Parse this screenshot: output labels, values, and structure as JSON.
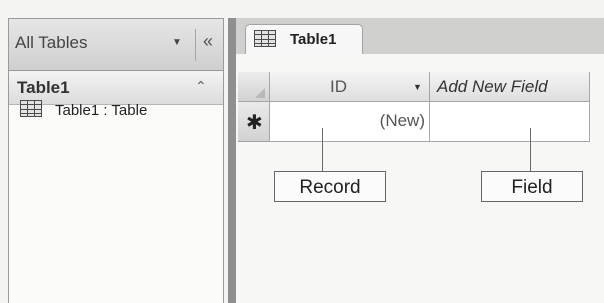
{
  "nav_pane": {
    "title": "All Tables",
    "dropdown_glyph": "▼",
    "shutter_glyph": "«",
    "group": {
      "title": "Table1",
      "collapse_glyph": "⌃"
    },
    "items": [
      {
        "label": "Table1 : Table",
        "icon": "table-icon"
      }
    ]
  },
  "document_tab": {
    "label": "Table1",
    "icon": "table-icon"
  },
  "datasheet": {
    "columns": [
      {
        "label": "ID",
        "sort_glyph": "▼"
      },
      {
        "label": "Add New Field"
      }
    ],
    "new_row": {
      "selector_glyph": "✱",
      "id_value": "(New)",
      "new_field_value": ""
    }
  },
  "callouts": {
    "record": "Record",
    "field": "Field"
  }
}
